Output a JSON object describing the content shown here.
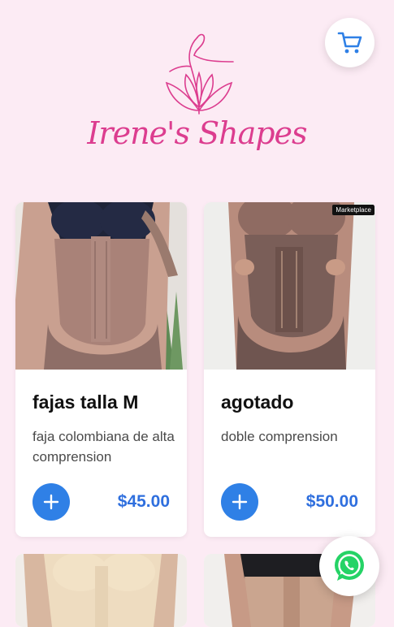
{
  "brand": {
    "name": "Irene's Shapes",
    "logo_icon": "lotus-woman-logo-icon",
    "accent": "#dc3d8f"
  },
  "cart": {
    "icon": "cart-icon"
  },
  "colors": {
    "background": "#fcebf4",
    "primary": "#2f80e6",
    "price": "#2f6fde"
  },
  "products": [
    {
      "title": "fajas talla M",
      "description": "faja colombiana de alta comprension",
      "price": "$45.00",
      "badge": ""
    },
    {
      "title": "agotado",
      "description": "doble comprension",
      "price": "$50.00",
      "badge": "Marketplace"
    }
  ],
  "whatsapp": {
    "icon": "whatsapp-icon"
  }
}
